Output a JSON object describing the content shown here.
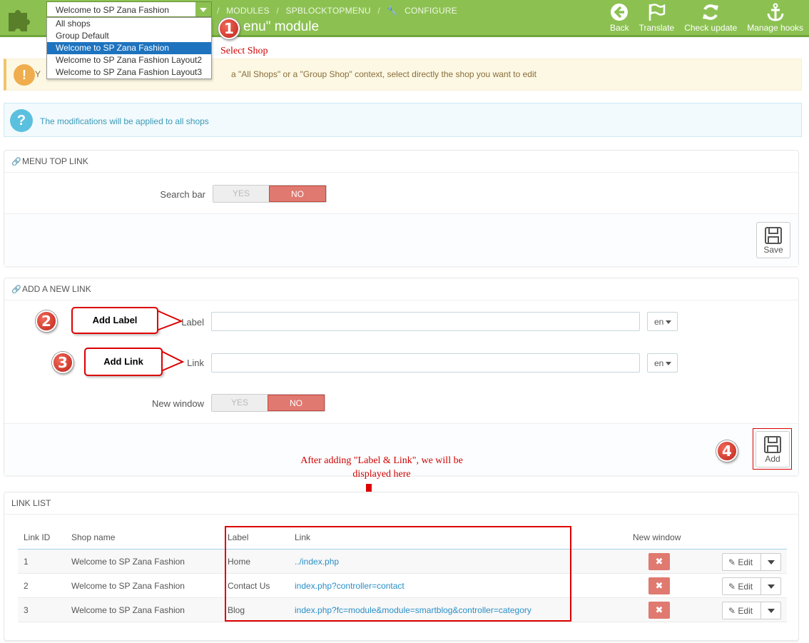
{
  "header": {
    "shop_select_value": "Welcome to SP Zana Fashion",
    "shop_options": [
      "All shops",
      "Group Default",
      "Welcome to SP Zana Fashion",
      "Welcome to SP Zana Fashion Layout2",
      "Welcome to SP Zana Fashion Layout3"
    ],
    "breadcrumb": [
      "MODULES",
      "SPBLOCKTOPMENU",
      "CONFIGURE"
    ],
    "breadcrumb_sep": "/",
    "title": "enu\" module",
    "toolbar": [
      "Back",
      "Translate",
      "Check update",
      "Manage hooks"
    ],
    "colors": {
      "header_bg": "#8cc152",
      "accent": "#d00000"
    }
  },
  "annotations": {
    "step1": "1",
    "step1_note": "Select Shop",
    "step2": "2",
    "step2_callout": "Add Label",
    "step3": "3",
    "step3_callout": "Add Link",
    "step4": "4",
    "list_note_line1": "After adding \"Label & Link\", we will be",
    "list_note_line2": "displayed here"
  },
  "alerts": {
    "warning_left": "Y",
    "warning": "a \"All Shops\" or a \"Group Shop\" context, select directly the shop you want to edit",
    "warning_icon": "!",
    "info": "The modifications will be applied to all shops",
    "info_icon": "?"
  },
  "menu_top_link": {
    "heading": "MENU TOP LINK",
    "search_bar_label": "Search bar",
    "yes": "YES",
    "no": "NO",
    "save": "Save"
  },
  "add_link": {
    "heading": "ADD A NEW LINK",
    "label_label": "Label",
    "link_label": "Link",
    "lang": "en",
    "new_window_label": "New window",
    "yes": "YES",
    "no": "NO",
    "add": "Add"
  },
  "link_list": {
    "heading": "LINK LIST",
    "columns": [
      "Link ID",
      "Shop name",
      "Label",
      "Link",
      "New window"
    ],
    "edit": "Edit",
    "rows": [
      {
        "id": "1",
        "shop": "Welcome to SP Zana Fashion",
        "label": "Home",
        "link": "../index.php"
      },
      {
        "id": "2",
        "shop": "Welcome to SP Zana Fashion",
        "label": "Contact Us",
        "link": "index.php?controller=contact"
      },
      {
        "id": "3",
        "shop": "Welcome to SP Zana Fashion",
        "label": "Blog",
        "link": "index.php?fc=module&module=smartblog&controller=category"
      }
    ]
  }
}
